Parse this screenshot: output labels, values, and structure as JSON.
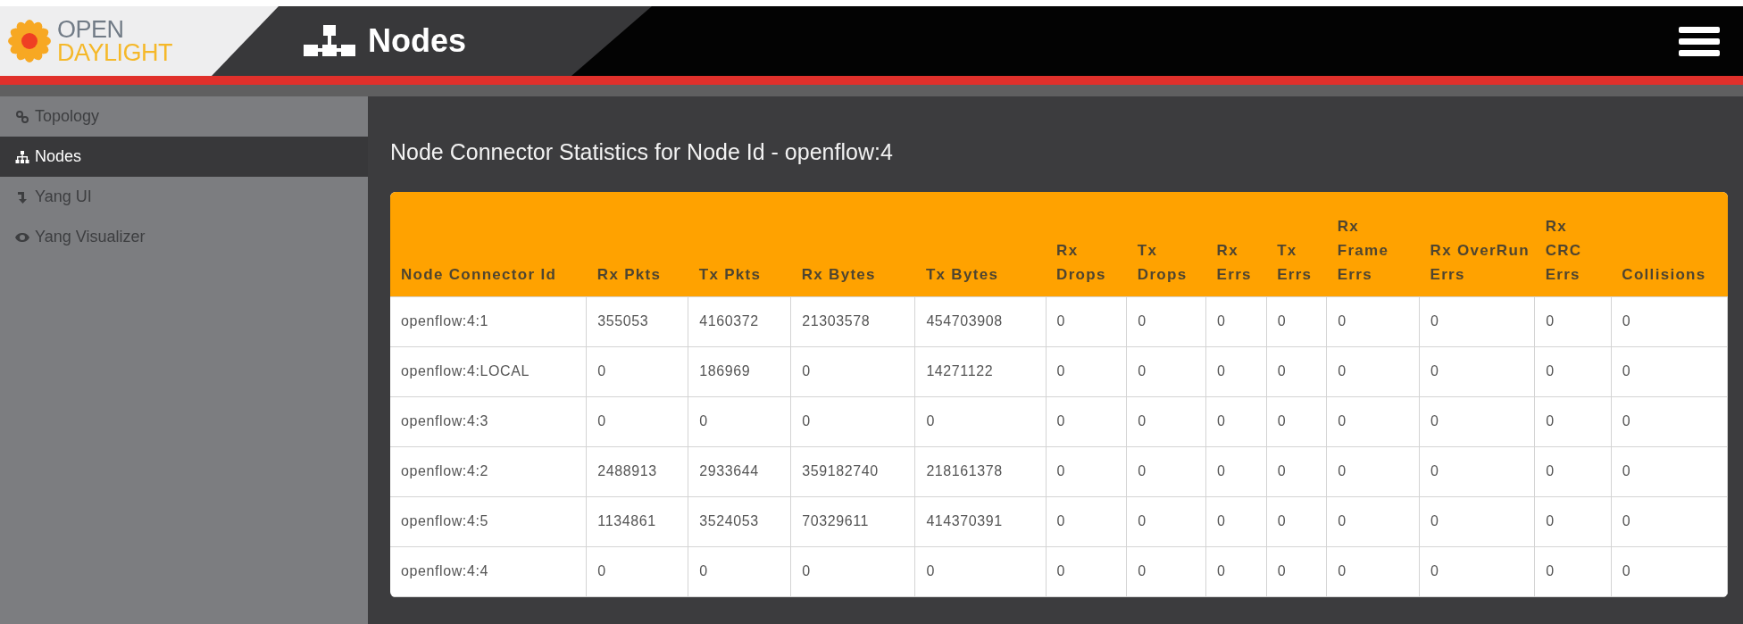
{
  "header": {
    "logo": {
      "line_1": "OPEN",
      "line_2": "DAYLIGHT"
    },
    "title": "Nodes"
  },
  "sidebar": {
    "items": [
      {
        "label": "Topology",
        "selected": false
      },
      {
        "label": "Nodes",
        "selected": true
      },
      {
        "label": "Yang UI",
        "selected": false
      },
      {
        "label": "Yang Visualizer",
        "selected": false
      }
    ]
  },
  "content": {
    "title": "Node Connector Statistics for Node Id - openflow:4"
  },
  "table": {
    "columns": [
      "Node Connector Id",
      "Rx Pkts",
      "Tx Pkts",
      "Rx Bytes",
      "Tx Bytes",
      "Rx Drops",
      "Tx Drops",
      "Rx Errs",
      "Tx Errs",
      "Rx Frame Errs",
      "Rx OverRun Errs",
      "Rx CRC Errs",
      "Collisions"
    ],
    "rows": [
      [
        "openflow:4:1",
        "355053",
        "4160372",
        "21303578",
        "454703908",
        "0",
        "0",
        "0",
        "0",
        "0",
        "0",
        "0",
        "0"
      ],
      [
        "openflow:4:LOCAL",
        "0",
        "186969",
        "0",
        "14271122",
        "0",
        "0",
        "0",
        "0",
        "0",
        "0",
        "0",
        "0"
      ],
      [
        "openflow:4:3",
        "0",
        "0",
        "0",
        "0",
        "0",
        "0",
        "0",
        "0",
        "0",
        "0",
        "0",
        "0"
      ],
      [
        "openflow:4:2",
        "2488913",
        "2933644",
        "359182740",
        "218161378",
        "0",
        "0",
        "0",
        "0",
        "0",
        "0",
        "0",
        "0"
      ],
      [
        "openflow:4:5",
        "1134861",
        "3524053",
        "70329611",
        "414370391",
        "0",
        "0",
        "0",
        "0",
        "0",
        "0",
        "0",
        "0"
      ],
      [
        "openflow:4:4",
        "0",
        "0",
        "0",
        "0",
        "0",
        "0",
        "0",
        "0",
        "0",
        "0",
        "0",
        "0"
      ]
    ]
  }
}
